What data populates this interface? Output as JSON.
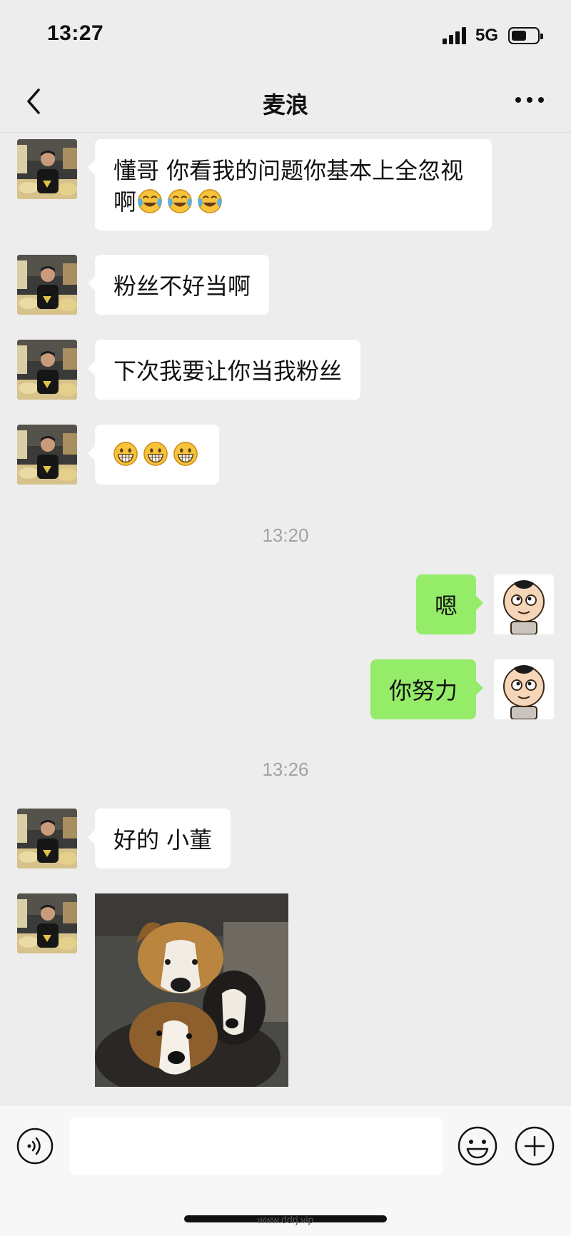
{
  "status_bar": {
    "time": "13:27",
    "network": "5G",
    "battery_level": 0.6
  },
  "nav": {
    "title": "麦浪",
    "back_icon": "chevron-left-icon",
    "more_icon": "more-dots-icon"
  },
  "messages": [
    {
      "side": "in",
      "text": "懂哥 你看我的问题你基本上全忽视啊",
      "emojis": [
        "tears-of-joy",
        "tears-of-joy",
        "tears-of-joy"
      ]
    },
    {
      "side": "in",
      "text": "粉丝不好当啊"
    },
    {
      "side": "in",
      "text": "下次我要让你当我粉丝"
    },
    {
      "side": "in",
      "text": "",
      "emojis": [
        "grin",
        "grin",
        "grin"
      ]
    },
    {
      "type": "time",
      "text": "13:20"
    },
    {
      "side": "out",
      "text": "嗯"
    },
    {
      "side": "out",
      "text": "你努力"
    },
    {
      "type": "time",
      "text": "13:26"
    },
    {
      "side": "in",
      "text": "好的 小董"
    },
    {
      "side": "in",
      "type": "image",
      "content": "three-dogs-photo"
    }
  ],
  "input_bar": {
    "placeholder": "",
    "voice_icon": "voice-icon",
    "emoji_icon": "emoji-icon",
    "plus_icon": "plus-icon"
  },
  "watermark": "www.ddrj.vip",
  "colors": {
    "background": "#ededed",
    "incoming_bubble": "#ffffff",
    "outgoing_bubble": "#95ec69",
    "timestamp": "#a3a3a3"
  }
}
